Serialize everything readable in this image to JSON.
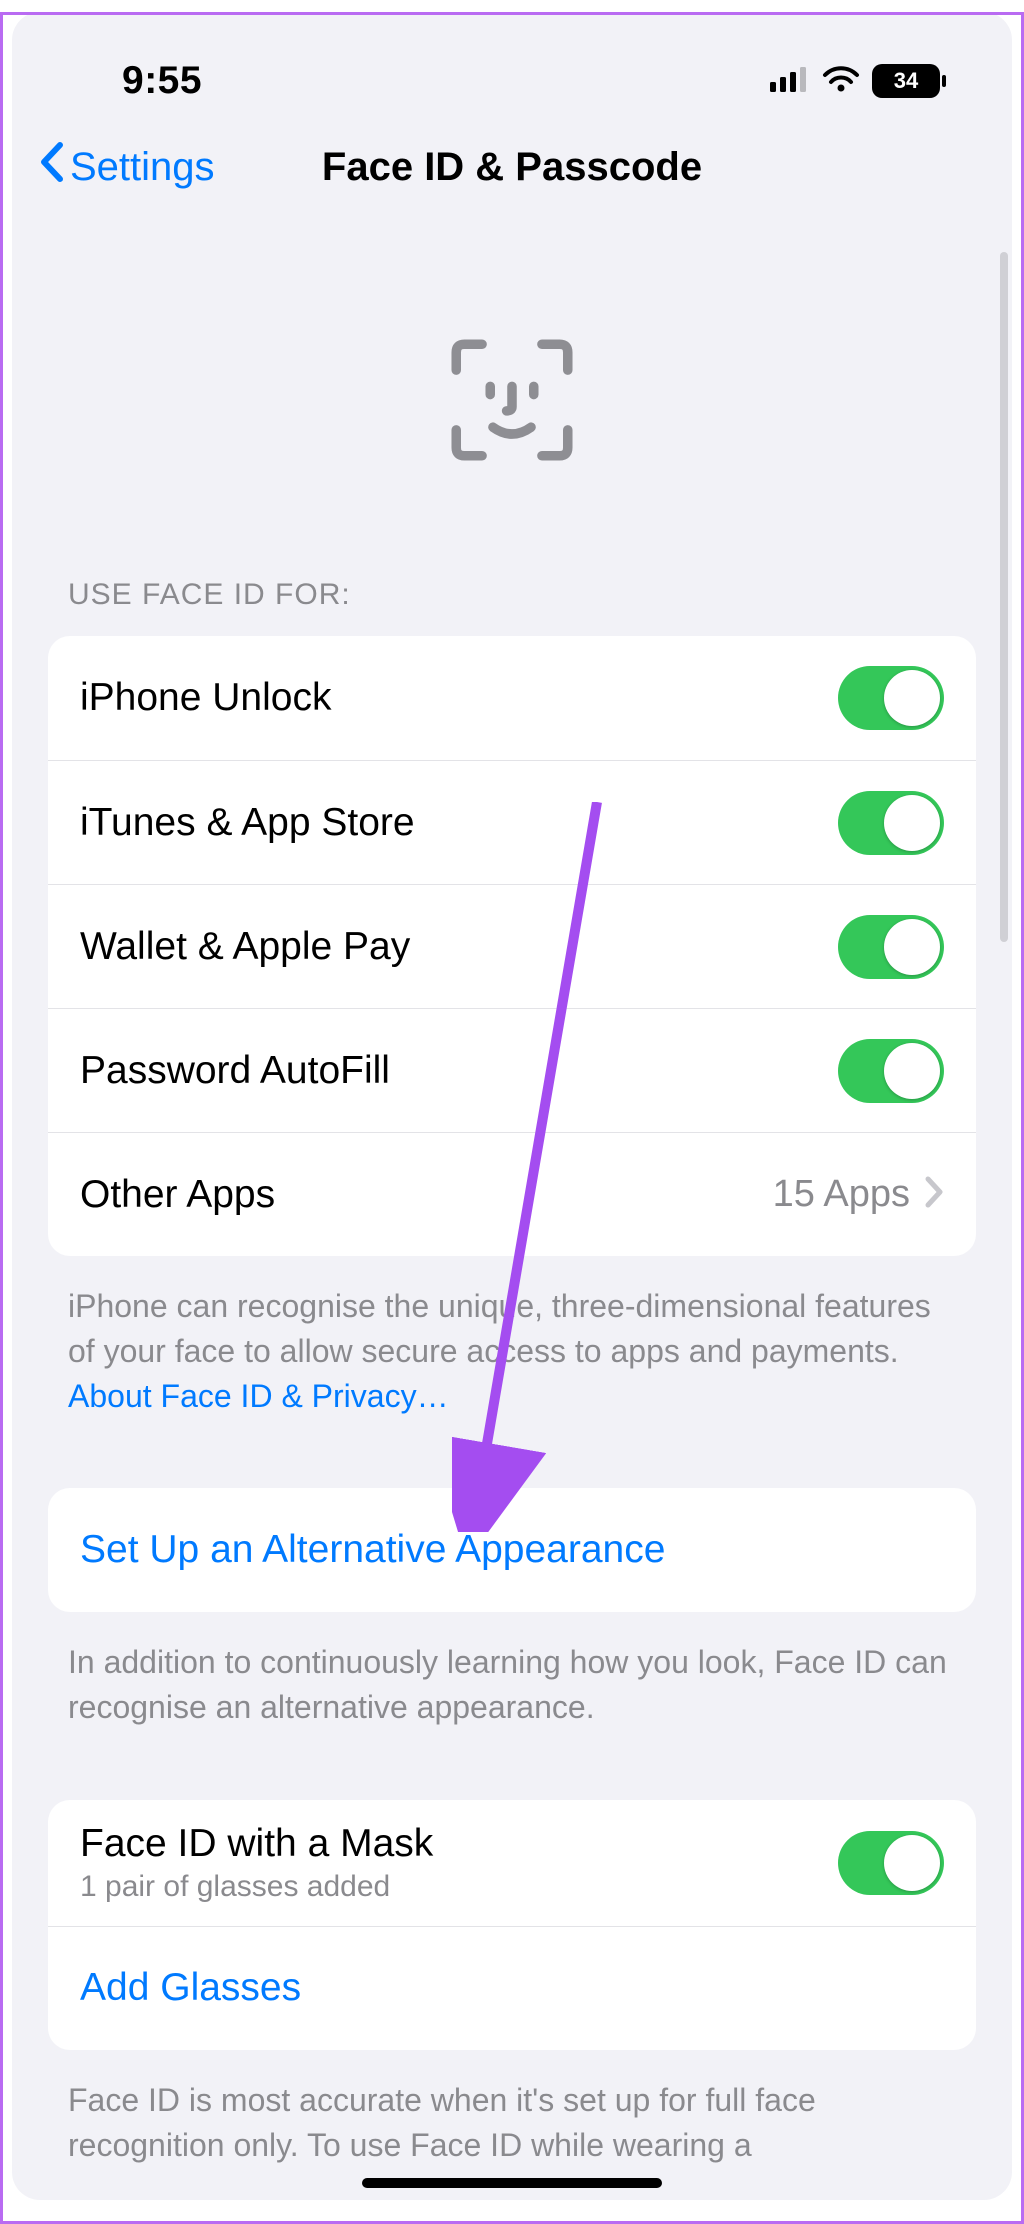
{
  "status": {
    "time": "9:55",
    "battery": "34"
  },
  "nav": {
    "back": "Settings",
    "title": "Face ID & Passcode"
  },
  "section1": {
    "header": "USE FACE ID FOR:"
  },
  "rows": {
    "unlock": "iPhone Unlock",
    "itunes": "iTunes & App Store",
    "wallet": "Wallet & Apple Pay",
    "autofill": "Password AutoFill",
    "other": "Other Apps",
    "other_detail": "15 Apps"
  },
  "footer1": {
    "text": "iPhone can recognise the unique, three-dimensional features of your face to allow secure access to apps and payments. ",
    "link": "About Face ID & Privacy…"
  },
  "alt": {
    "label": "Set Up an Alternative Appearance"
  },
  "footer2": "In addition to continuously learning how you look, Face ID can recognise an alternative appearance.",
  "mask": {
    "label": "Face ID with a Mask",
    "sub": "1 pair of glasses added",
    "add": "Add Glasses"
  },
  "footer3": "Face ID is most accurate when it's set up for full face recognition only. To use Face ID while wearing a"
}
